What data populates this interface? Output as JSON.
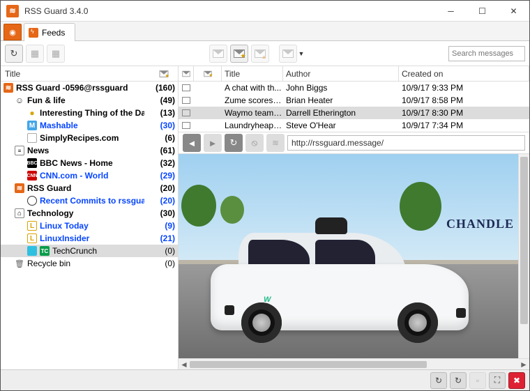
{
  "window": {
    "title": "RSS Guard 3.4.0"
  },
  "tabs": {
    "feeds": "Feeds"
  },
  "toolbar": {
    "search_placeholder": "Search messages"
  },
  "left": {
    "header_title": "Title",
    "items": [
      {
        "ind": 0,
        "icon": "rss",
        "iconText": "≋",
        "label": "RSS Guard -0596@rssguard",
        "count": "(160)",
        "bold": true
      },
      {
        "ind": 1,
        "icon": "smile",
        "iconText": "☺",
        "label": "Fun & life",
        "count": "(49)",
        "bold": true
      },
      {
        "ind": 2,
        "icon": "bulb",
        "iconText": "●",
        "label": "Interesting Thing of the Day",
        "count": "(13)",
        "bold": true
      },
      {
        "ind": 2,
        "icon": "mash",
        "iconText": "M",
        "label": "Mashable",
        "count": "(30)",
        "bold": true,
        "blue": true
      },
      {
        "ind": 2,
        "icon": "simply",
        "iconText": "",
        "label": "SimplyRecipes.com",
        "count": "(6)",
        "bold": true
      },
      {
        "ind": 1,
        "icon": "news",
        "iconText": "≡",
        "label": "News",
        "count": "(61)",
        "bold": true
      },
      {
        "ind": 2,
        "icon": "bbc",
        "iconText": "BBC",
        "label": "BBC News - Home",
        "count": "(32)",
        "bold": true
      },
      {
        "ind": 2,
        "icon": "cnn",
        "iconText": "CNN",
        "label": "CNN.com - World",
        "count": "(29)",
        "bold": true,
        "blue": true
      },
      {
        "ind": 1,
        "icon": "rss",
        "iconText": "≋",
        "label": "RSS Guard",
        "count": "(20)",
        "bold": true
      },
      {
        "ind": 2,
        "icon": "gh",
        "iconText": "",
        "label": "Recent Commits to rssgua...",
        "count": "(20)",
        "bold": true,
        "blue": true
      },
      {
        "ind": 1,
        "icon": "tech",
        "iconText": "⌂",
        "label": "Technology",
        "count": "(30)",
        "bold": true
      },
      {
        "ind": 2,
        "icon": "lt",
        "iconText": "L",
        "label": "Linux Today",
        "count": "(9)",
        "bold": true,
        "blue": true
      },
      {
        "ind": 2,
        "icon": "li",
        "iconText": "L",
        "label": "LinuxInsider",
        "count": "(21)",
        "bold": true,
        "blue": true
      },
      {
        "ind": 2,
        "icon": "tc",
        "iconText": "TC",
        "label": "TechCrunch",
        "count": "(0)",
        "bold": false,
        "selected": true,
        "preIcon": "cyan"
      },
      {
        "ind": 1,
        "icon": "bin",
        "iconText": "🗑",
        "label": "Recycle bin",
        "count": "(0)",
        "bold": false
      }
    ]
  },
  "msglist": {
    "header": {
      "title": "Title",
      "author": "Author",
      "created": "Created on"
    },
    "rows": [
      {
        "title": "A chat with th...",
        "author": "John Biggs",
        "date": "10/9/17 9:33 PM"
      },
      {
        "title": "Zume scores $...",
        "author": "Brian Heater",
        "date": "10/9/17 8:58 PM"
      },
      {
        "title": "Waymo teams...",
        "author": "Darrell Etherington",
        "date": "10/9/17 8:30 PM",
        "selected": true
      },
      {
        "title": "Laundryheap,...",
        "author": "Steve O&#039;Hear",
        "date": "10/9/17 7:34 PM"
      }
    ]
  },
  "preview": {
    "url": "http://rssguard.message/",
    "sign": "CHANDLE",
    "carlogo": "W"
  }
}
